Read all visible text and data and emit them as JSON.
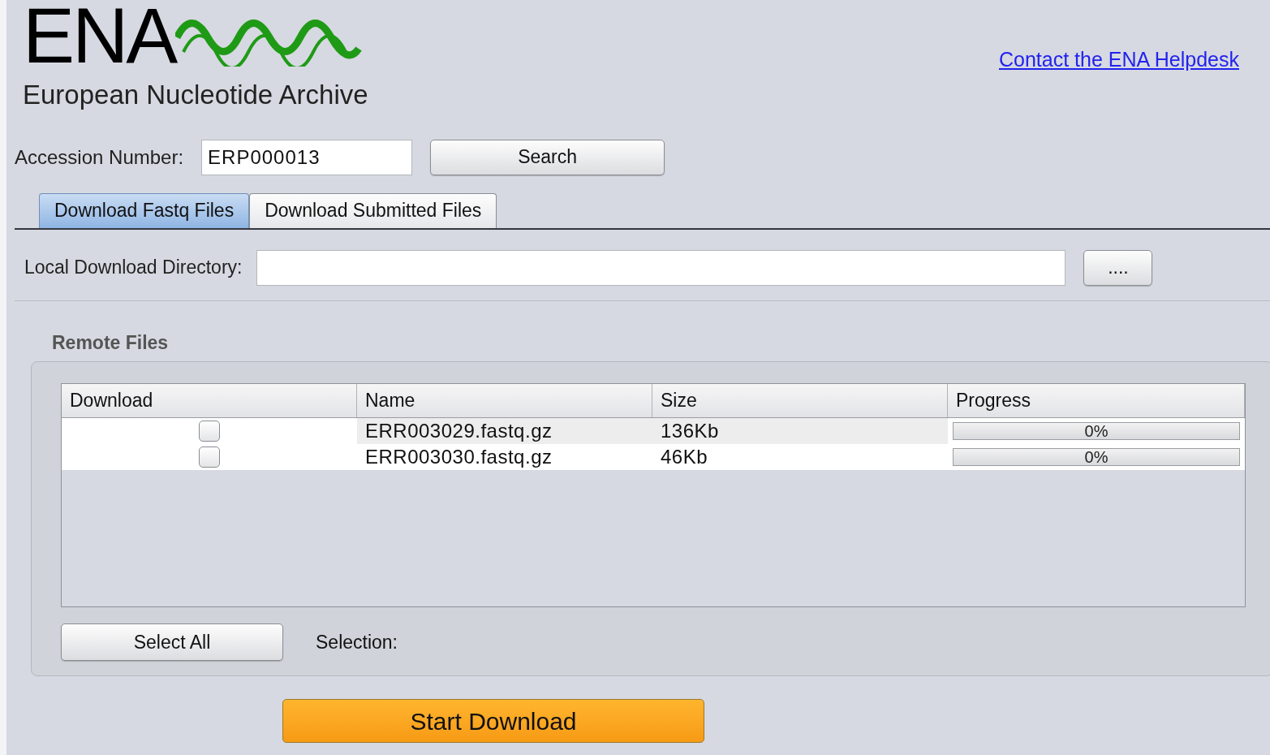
{
  "logo": {
    "acronym": "ENA",
    "subtitle": "European Nucleotide Archive"
  },
  "helpdesk_link": "Contact the ENA Helpdesk",
  "accession": {
    "label": "Accession Number:",
    "value": "ERP000013",
    "button": "Search"
  },
  "tabs": [
    {
      "label": "Download Fastq Files",
      "selected": true
    },
    {
      "label": "Download Submitted Files",
      "selected": false
    }
  ],
  "directory": {
    "label": "Local Download Directory:",
    "button": "...."
  },
  "remote_files": {
    "title": "Remote Files",
    "columns": [
      "Download",
      "Name",
      "Size",
      "Progress"
    ],
    "rows": [
      {
        "checked": false,
        "name": "ERR003029.fastq.gz",
        "size": "136Kb",
        "level": 0,
        "reading": "0%"
      },
      {
        "checked": false,
        "name": "ERR003030.fastq.gz",
        "size": "46Kb",
        "level": 0,
        "reading": "0%"
      }
    ],
    "select_all": "Select All",
    "selection_label": "Selection:"
  },
  "start_button": "Start Download"
}
